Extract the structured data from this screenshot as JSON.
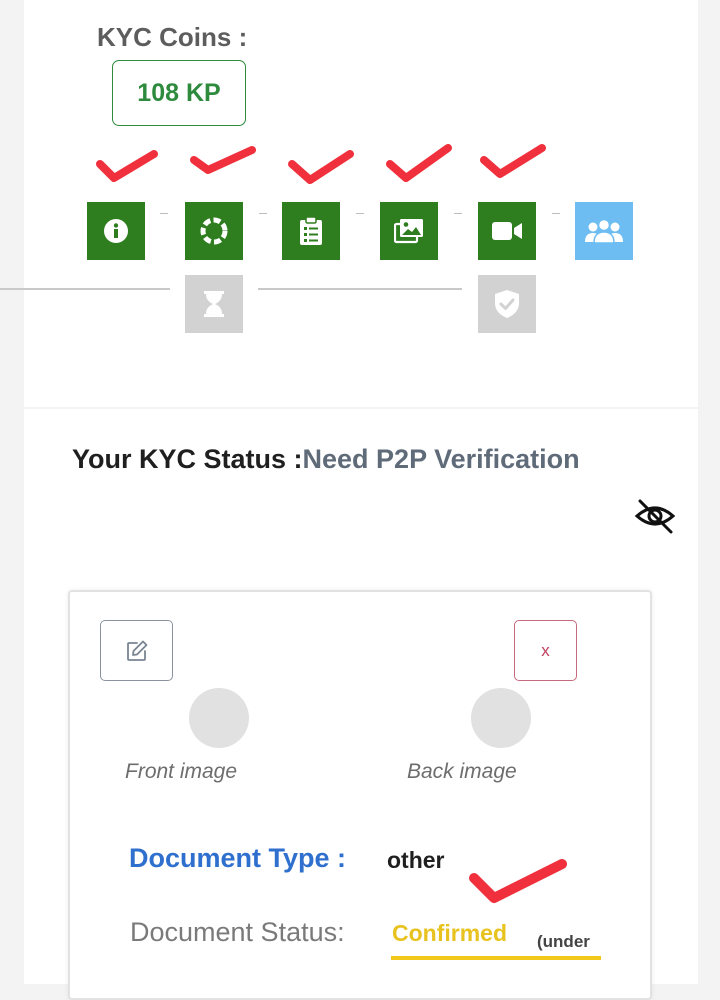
{
  "kyc_coins": {
    "title": "KYC Coins :",
    "value": "108 KP"
  },
  "steps": [
    {
      "name": "info",
      "icon": "info-icon",
      "state": "done",
      "checked": true
    },
    {
      "name": "lifebuoy",
      "icon": "lifebuoy-icon",
      "state": "done",
      "checked": true
    },
    {
      "name": "clipboard",
      "icon": "clipboard-list-icon",
      "state": "done",
      "checked": true
    },
    {
      "name": "images",
      "icon": "images-icon",
      "state": "done",
      "checked": true
    },
    {
      "name": "video",
      "icon": "video-camera-icon",
      "state": "done",
      "checked": true
    },
    {
      "name": "users",
      "icon": "users-icon",
      "state": "active",
      "checked": false
    }
  ],
  "sub_steps": [
    {
      "name": "pending",
      "icon": "hourglass-icon"
    },
    {
      "name": "verified",
      "icon": "shield-check-icon"
    }
  ],
  "kyc_status": {
    "label": "Your KYC Status :",
    "value": "Need P2P Verification",
    "toggle_icon": "eye-slash-icon"
  },
  "document": {
    "edit_icon": "edit-icon",
    "close_label": "x",
    "front_label": "Front image",
    "back_label": "Back image",
    "type_label": "Document Type :",
    "type_value": "other",
    "status_label": "Document Status:",
    "status_value": "Confirmed",
    "status_note": "(under"
  },
  "colors": {
    "done": "#2e7d1f",
    "active": "#6dbdf2",
    "pending": "#d2d2d2",
    "accent_green": "#2e8b3e",
    "doc_type_blue": "#2f6fce",
    "confirmed_yellow": "#e8c21e",
    "annotation_red": "#f0303c"
  }
}
